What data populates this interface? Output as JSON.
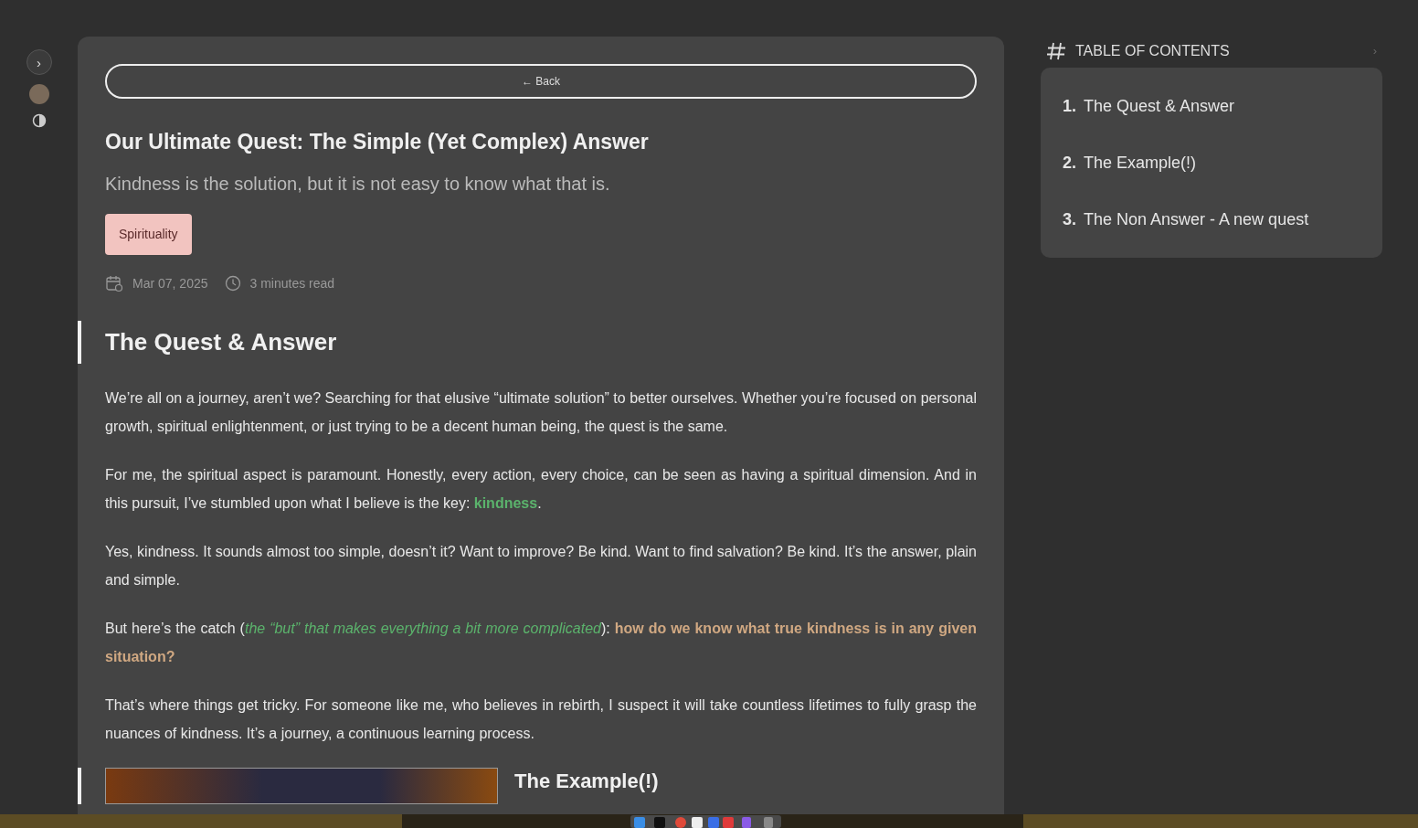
{
  "rail": {
    "toggle": "›"
  },
  "article": {
    "back": "← Back",
    "title": "Our Ultimate Quest: The Simple (Yet Complex) Answer",
    "subtitle": "Kindness is the solution, but it is not easy to know what that is.",
    "tags": [
      {
        "label": "Spirituality",
        "color": "#f2c4c0"
      }
    ],
    "date": "Mar 07, 2025",
    "read_time": "3 minutes read",
    "section": {
      "heading": "The Quest & Answer",
      "paragraphs": [
        [
          {
            "kind": "plain",
            "text": "We’re all on a journey, aren’t we? Searching for that elusive “ultimate solution” to better ourselves. Whether you’re focused on personal growth, spiritual enlightenment, or just trying to be a decent human being, the quest is the same."
          }
        ],
        [
          {
            "kind": "plain",
            "text": "For me, the spiritual aspect is paramount. Honestly, every action, every choice, can be seen as having a spiritual dimension. And in this pursuit, I’ve stumbled upon what I believe is the key: "
          },
          {
            "kind": "link",
            "text": "kindness"
          },
          {
            "kind": "plain",
            "text": "."
          }
        ],
        [
          {
            "kind": "plain",
            "text": "Yes, kindness. It sounds almost too simple, doesn’t it? Want to improve? Be kind. Want to find salvation? Be kind. It’s the answer, plain and simple."
          }
        ],
        [
          {
            "kind": "plain",
            "text": "But here’s the catch ("
          },
          {
            "kind": "aside",
            "text": "the “but” that makes everything a bit more complicated"
          },
          {
            "kind": "plain",
            "text": "): "
          },
          {
            "kind": "emphasis",
            "text": "how do we know what true kindness is in any given situation?"
          }
        ],
        [
          {
            "kind": "plain",
            "text": "That’s where things get tricky. For someone like me, who believes in rebirth, I suspect it will take countless lifetimes to fully grasp the nuances of kindness. It’s a journey, a continuous learning process."
          }
        ]
      ]
    },
    "next_heading": "The Example(!)"
  },
  "toc": {
    "title": "TABLE OF CONTENTS",
    "toggle": "›",
    "items": [
      {
        "number": "1.",
        "label": "The Quest & Answer"
      },
      {
        "number": "2.",
        "label": "The Example(!)"
      },
      {
        "number": "3.",
        "label": "The Non Answer - A new quest"
      }
    ]
  }
}
